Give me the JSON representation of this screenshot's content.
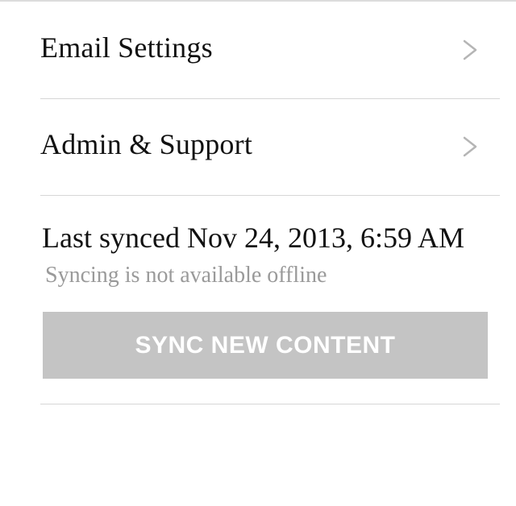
{
  "settings": {
    "items": [
      {
        "label": "Email Settings",
        "icon": "chevron-right-icon"
      },
      {
        "label": "Admin & Support",
        "icon": "chevron-right-icon"
      }
    ]
  },
  "sync": {
    "last_synced": "Last synced Nov 24, 2013, 6:59 AM",
    "offline_note": "Syncing is not available offline",
    "button_label": "SYNC NEW CONTENT",
    "button_disabled": true
  },
  "colors": {
    "text": "#111111",
    "muted_text": "#9a9a9a",
    "divider": "#d6d6d6",
    "chevron": "#b5b5b5",
    "disabled_button": "#c4c4c4",
    "button_text": "#ffffff"
  }
}
